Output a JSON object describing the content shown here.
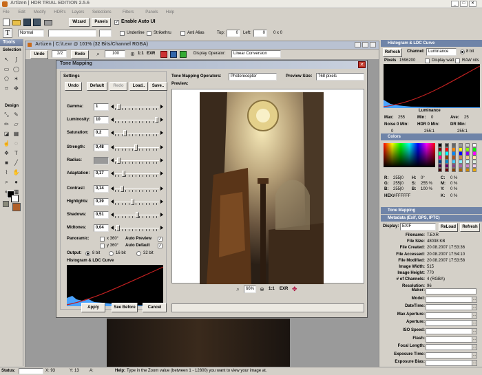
{
  "app": {
    "title": "Artizen | HDR TRIAL EDITION 2.5.6"
  },
  "menu": [
    "File",
    "Edit",
    "Modify",
    "HDR's",
    "Layers",
    "Selections",
    "Filters",
    "Panels",
    "Help"
  ],
  "toolbar": {
    "wizard": "Wizard",
    "panels": "Panels",
    "enable_auto_ui": "Enable Auto UI",
    "blend_mode": "Normal",
    "underline": "Underline",
    "strikethru": "Strikethru",
    "anti_alias": "Anti Alias",
    "top_label": "Top:",
    "top_value": "0",
    "left_label": "Left:",
    "left_value": "0",
    "size": "0 x 0",
    "glyph": "T"
  },
  "tools": {
    "title": "Tools",
    "selection": "Selection",
    "design": "Design"
  },
  "doc": {
    "title": "Artizen | C:\\t.exr @ 101% (32 Bits/Channel RGBA)",
    "undo": "Undo",
    "history": "2/2",
    "redo": "Redo",
    "zoom": "100",
    "display_operator_label": "Display Operator:",
    "display_operator": "Linear Conversion"
  },
  "dialog": {
    "title": "Tone Mapping",
    "settings": "Settings",
    "undo": "Undo",
    "default": "Default",
    "redo": "Redo",
    "load": "Load..",
    "save": "Save..",
    "sliders": [
      {
        "label": "Gamma:",
        "value": "1",
        "pos": 0.05,
        "disabled": false
      },
      {
        "label": "Luminosity:",
        "value": "10",
        "pos": 1.0,
        "disabled": false
      },
      {
        "label": "Saturation:",
        "value": "0,2",
        "pos": 0.2,
        "disabled": false
      },
      {
        "label": "Strength:",
        "value": "0,48",
        "pos": 0.48,
        "disabled": false
      },
      {
        "label": "Radius:",
        "value": "",
        "pos": 0.05,
        "disabled": true
      },
      {
        "label": "Adaptation:",
        "value": "0,17",
        "pos": 0.17,
        "disabled": false
      },
      {
        "label": "Contrast:",
        "value": "0,14",
        "pos": 0.14,
        "disabled": false
      },
      {
        "label": "Highlights:",
        "value": "0,39",
        "pos": 0.39,
        "disabled": false
      },
      {
        "label": "Shadows:",
        "value": "0,51",
        "pos": 0.51,
        "disabled": false
      },
      {
        "label": "Midtones:",
        "value": "0,04",
        "pos": 0.04,
        "disabled": false
      }
    ],
    "panoramic": "Panoramic:",
    "x360": "x 360°",
    "y360": "y 360°",
    "auto_preview": "Auto Preview",
    "auto_default": "Auto Default",
    "output": "Output:",
    "bit8": "8 bit",
    "bit16": "16 bit",
    "bit32": "32 bit",
    "histogram": "Histogram & LDC Curve",
    "apply": "Apply",
    "see_before": "See Before",
    "cancel": "Cancel",
    "operators_label": "Tone Mapping Operators:",
    "operator": "Photoreceptor",
    "preview_size_label": "Preview Size:",
    "preview_size": "768 pixels",
    "preview": "Preview:",
    "zoom": "66%"
  },
  "histogram_panel": {
    "title": "Histogram & LDC Curve",
    "refresh": "Refresh",
    "channel_label": "Channel:",
    "channel": "Luminance",
    "bit": "8 bit",
    "pixels_label": "Pixels",
    "pixels": "1596200",
    "display_watt": "Display watt",
    "raw_nits": "RAW nits",
    "luminance": "Luminance",
    "stats": [
      {
        "k": "Max:",
        "v": "255"
      },
      {
        "k": "Min:",
        "v": "0"
      },
      {
        "k": "Ave:",
        "v": "25"
      },
      {
        "k": "Noise 0 Min:",
        "v": "0"
      },
      {
        "k": "HDR 0 Min:",
        "v": "255:1"
      },
      {
        "k": "DR Min:",
        "v": "255:1"
      }
    ]
  },
  "colors": {
    "title": "Colors",
    "r": "255|0",
    "g": "255|0",
    "b": "255|0",
    "h": "0°",
    "s": "255 %",
    "bv": "100 %",
    "c": "0 %",
    "m": "0 %",
    "y": "0 %",
    "k": "0 %",
    "hex_label": "HEX:",
    "hex": "#FFFFFF",
    "labels": {
      "r": "R:",
      "g": "G:",
      "b": "B:",
      "h": "H:",
      "s": "S:",
      "bb": "B:",
      "c": "C:",
      "m": "M:",
      "y": "Y:",
      "k": "K:"
    }
  },
  "tone_mapping_panel": {
    "title": "Tone Mapping"
  },
  "metadata": {
    "title": "Metadata (Exif, GPS, IPTC)",
    "display_label": "Display:",
    "display": "EXIF",
    "reload": "ReLoad",
    "refresh": "Refresh",
    "rows": [
      {
        "k": "Filename:",
        "v": "T.EXR"
      },
      {
        "k": "File Size:",
        "v": "48038 KB"
      },
      {
        "k": "File Created:",
        "v": "20.08.2007 17:53:36"
      },
      {
        "k": "File Accessed:",
        "v": "20.08.2007 17:54:10"
      },
      {
        "k": "File Modified:",
        "v": "20.08.2007 17:53:58"
      },
      {
        "k": "Image Width:",
        "v": "515"
      },
      {
        "k": "Image Height:",
        "v": "770"
      },
      {
        "k": "# of Channels:",
        "v": "4 (RGBA)"
      },
      {
        "k": "Resolution:",
        "v": "96"
      }
    ],
    "fields": [
      "Maker:",
      "Model:",
      "DateTime:",
      "Max Aperture:",
      "Aperture:",
      "ISO Speed:",
      "Flash:",
      "Focal Length:",
      "Exposure Time:",
      "Exposure Bias:"
    ]
  },
  "status": {
    "label": "Status:",
    "x": "X: 93",
    "y": "Y: 13",
    "a": "A:",
    "help": "Help:",
    "help_text": "Type in the Zoom value (between 1 - 12800) you want to view your image at."
  }
}
